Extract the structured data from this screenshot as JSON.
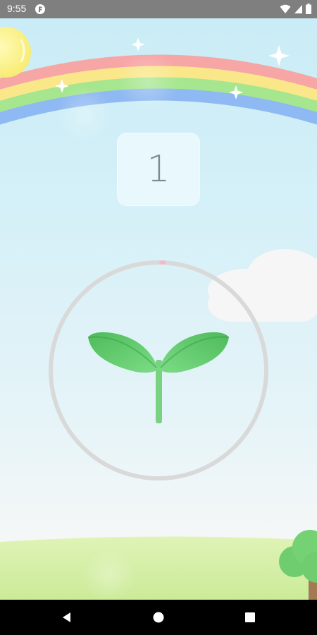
{
  "status_bar": {
    "time": "9:55",
    "app_icon": "app-notification-icon",
    "icons": [
      "wifi-icon",
      "signal-icon",
      "battery-icon"
    ],
    "color": "#7f7f7f"
  },
  "game": {
    "counter": "1",
    "ring_color": "#d9d9d9",
    "ring_marker_color": "#f7b9c8",
    "sprout_color": "#6cd277"
  },
  "nav_bar": {
    "icons": [
      "back-icon",
      "home-icon",
      "recents-icon"
    ]
  }
}
